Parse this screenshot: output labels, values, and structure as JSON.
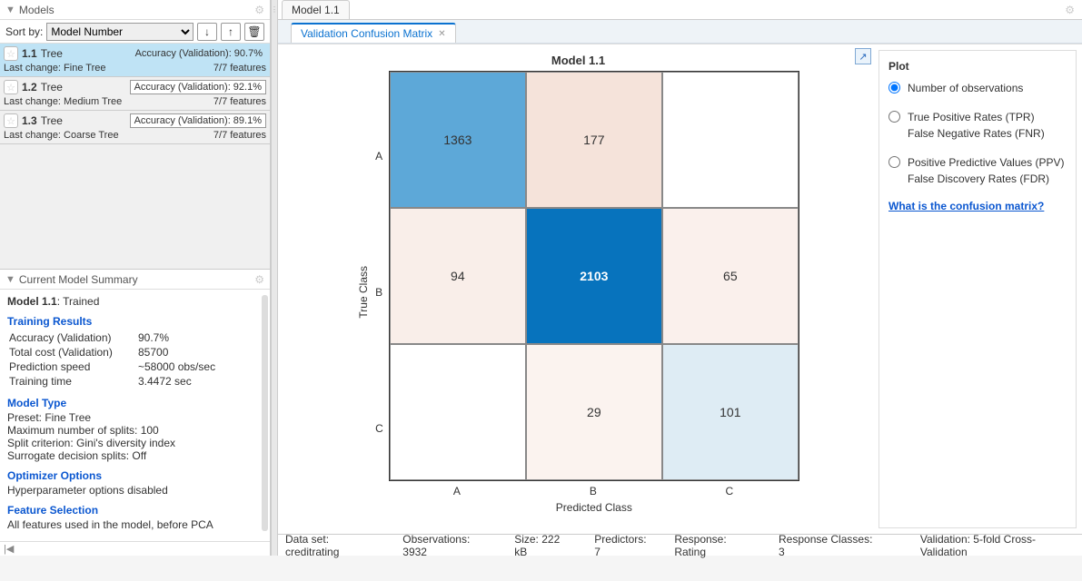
{
  "panels": {
    "models_title": "Models",
    "summary_title": "Current Model Summary",
    "plot_title": "Plot"
  },
  "sort": {
    "label": "Sort by:",
    "value": "Model Number",
    "options": [
      "Model Number"
    ]
  },
  "models": [
    {
      "id": "1.1",
      "type": "Tree",
      "accuracy_label": "Accuracy (Validation):",
      "accuracy": "90.7%",
      "last_change": "Last change: Fine Tree",
      "features": "7/7 features",
      "selected": true
    },
    {
      "id": "1.2",
      "type": "Tree",
      "accuracy_label": "Accuracy (Validation):",
      "accuracy": "92.1%",
      "last_change": "Last change: Medium Tree",
      "features": "7/7 features",
      "selected": false
    },
    {
      "id": "1.3",
      "type": "Tree",
      "accuracy_label": "Accuracy (Validation):",
      "accuracy": "89.1%",
      "last_change": "Last change: Coarse Tree",
      "features": "7/7 features",
      "selected": false
    }
  ],
  "summary": {
    "model_label": "Model 1.1",
    "model_status": ": Trained",
    "training_header": "Training Results",
    "accuracy_label": "Accuracy (Validation)",
    "accuracy": "90.7%",
    "cost_label": "Total cost (Validation)",
    "cost": "85700",
    "speed_label": "Prediction speed",
    "speed": "~58000 obs/sec",
    "time_label": "Training time",
    "time": "3.4472 sec",
    "model_type_header": "Model Type",
    "preset": "Preset: Fine Tree",
    "splits": "Maximum number of splits: 100",
    "criterion": "Split criterion: Gini's diversity index",
    "surrogate": "Surrogate decision splits: Off",
    "optimizer_header": "Optimizer Options",
    "optimizer_text": "Hyperparameter options disabled",
    "feature_header": "Feature Selection",
    "feature_text": "All features used in the model, before PCA"
  },
  "tabs": {
    "model_tab": "Model 1.1",
    "sub_tab": "Validation Confusion Matrix"
  },
  "chart_data": {
    "type": "heatmap",
    "title": "Model 1.1",
    "xlabel": "Predicted Class",
    "ylabel": "True Class",
    "categories": [
      "A",
      "B",
      "C"
    ],
    "matrix": [
      [
        1363,
        177,
        null
      ],
      [
        94,
        2103,
        65
      ],
      [
        null,
        29,
        101
      ]
    ],
    "colors": [
      [
        "#5da8d8",
        "#f5e3da",
        "#ffffff"
      ],
      [
        "#f9eee9",
        "#0773bd",
        "#faf0ec"
      ],
      [
        "#ffffff",
        "#fbf3ef",
        "#deecf4"
      ]
    ],
    "text_colors": [
      [
        "#333",
        "#333",
        "#333"
      ],
      [
        "#333",
        "#fff",
        "#333"
      ],
      [
        "#333",
        "#333",
        "#333"
      ]
    ]
  },
  "plot_options": {
    "opt1": "Number of observations",
    "opt2a": "True Positive Rates (TPR)",
    "opt2b": "False Negative Rates (FNR)",
    "opt3a": "Positive Predictive Values (PPV)",
    "opt3b": "False Discovery Rates (FDR)",
    "link": "What is the confusion matrix?"
  },
  "status": {
    "dataset": "Data set: creditrating",
    "observations": "Observations: 3932",
    "size": "Size: 222 kB",
    "predictors": "Predictors: 7",
    "response": "Response: Rating",
    "classes": "Response Classes: 3",
    "validation": "Validation: 5-fold Cross-Validation"
  }
}
